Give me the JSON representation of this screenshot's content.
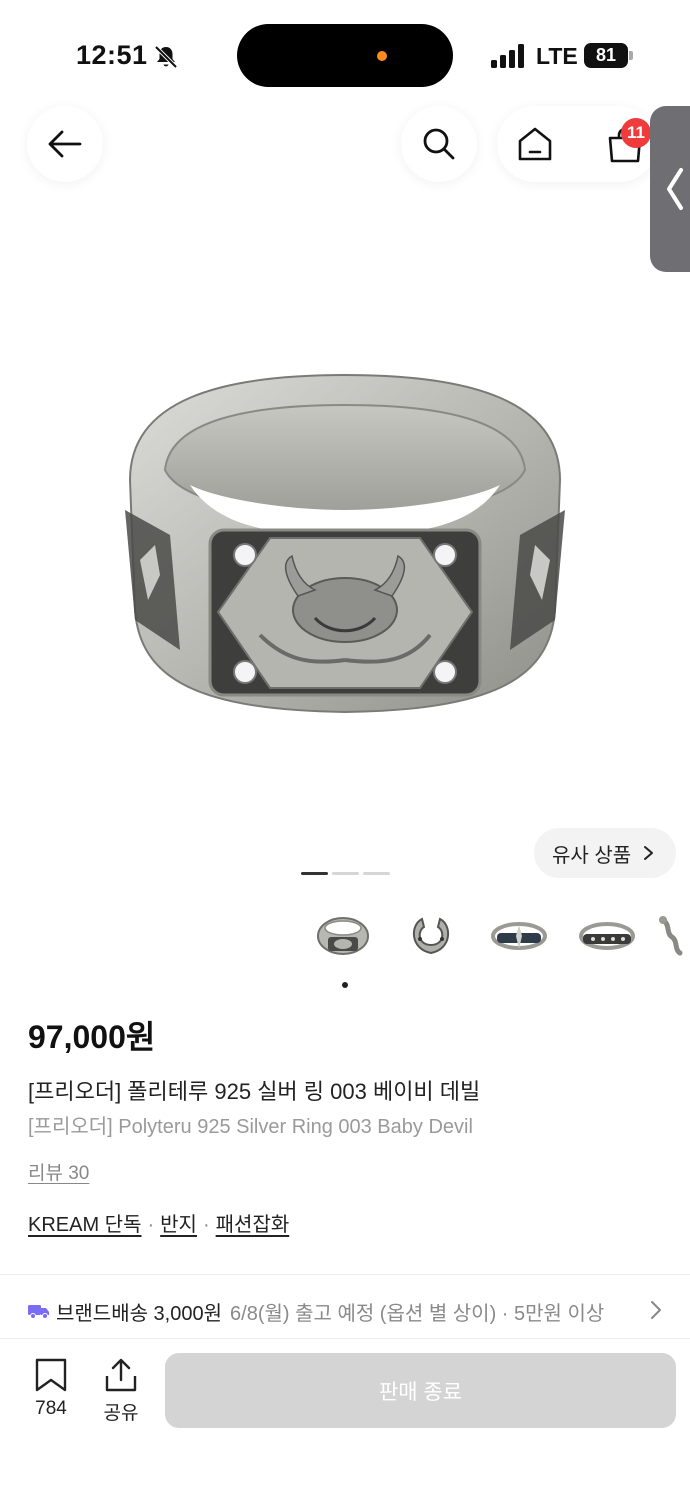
{
  "status_bar": {
    "time": "12:51",
    "network": "LTE",
    "battery": "81"
  },
  "nav": {
    "back_icon": "arrow-left-icon",
    "search_icon": "search-icon",
    "home_icon": "home-icon",
    "cart_icon": "shopping-bag-icon",
    "cart_badge": "11"
  },
  "gallery": {
    "similar_label": "유사 상품",
    "current_page": 1,
    "page_count": 3
  },
  "product": {
    "price": "97,000원",
    "title_ko": "[프리오더] 폴리테루 925 실버 링 003 베이비 데빌",
    "title_en": "[프리오더] Polyteru 925 Silver Ring 003 Baby Devil",
    "review": "리뷰 30",
    "tags": [
      "KREAM 단독",
      "반지",
      "패션잡화"
    ],
    "tag_separator": "·"
  },
  "shipping": {
    "label": "브랜드배송 3,000원",
    "detail": "6/8(월) 출고 예정 (옵션 별 상이) · 5만원 이상"
  },
  "bottom": {
    "save_count": "784",
    "share_label": "공유",
    "cta_label": "판매 종료"
  },
  "colors": {
    "badge": "#ef3b3b",
    "shipping_icon": "#7b6cf6",
    "cta_disabled": "#d4d4d4"
  }
}
